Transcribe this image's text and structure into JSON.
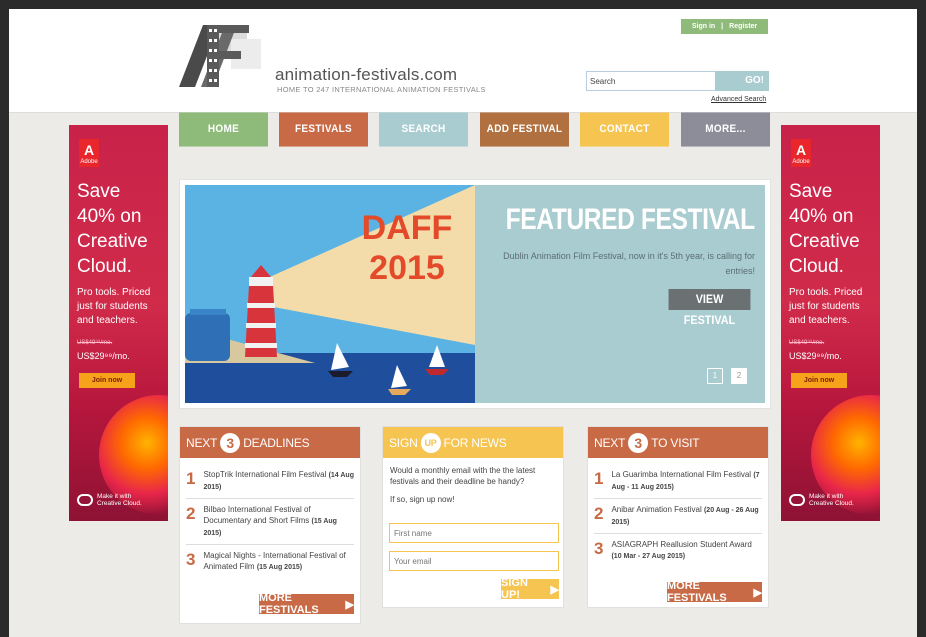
{
  "header": {
    "site_title": "animation-festivals.com",
    "tagline": "HOME TO 247 INTERNATIONAL ANIMATION FESTIVALS",
    "sign_in": "Sign in",
    "divider": "|",
    "register": "Register",
    "search_value": "Search",
    "search_button": "GO!",
    "advanced_search": "Advanced Search"
  },
  "nav": [
    {
      "label": "HOME",
      "color": "#8fbb7a"
    },
    {
      "label": "FESTIVALS",
      "color": "#c86a45"
    },
    {
      "label": "SEARCH",
      "color": "#a9ccd0"
    },
    {
      "label": "ADD FESTIVAL",
      "color": "#b0703f"
    },
    {
      "label": "CONTACT",
      "color": "#f5c451"
    },
    {
      "label": "MORE...",
      "color": "#8d8d9a"
    }
  ],
  "ad": {
    "brand": "Adobe",
    "headline_lines": [
      "Save",
      "40% on",
      "Creative",
      "Cloud."
    ],
    "body_lines": [
      "Pro tools. Priced",
      "just for students",
      "and teachers."
    ],
    "old_price": "US$49⁹⁹/mo.",
    "new_price": "US$29⁹⁹/mo.",
    "cta": "Join now",
    "footer_lines": [
      "Make it with",
      "Creative Cloud."
    ]
  },
  "hero": {
    "art_title_lines": [
      "DAFF",
      "2015"
    ],
    "heading": "FEATURED FESTIVAL",
    "description": "Dublin Animation Film Festival, now in it's 5th year, is calling for entries!",
    "button": "VIEW FESTIVAL",
    "pages": [
      "1",
      "2"
    ]
  },
  "deadlines": {
    "title_prefix": "NEXT",
    "title_num": "3",
    "title_suffix": "DEADLINES",
    "items": [
      {
        "num": "1",
        "name": "StopTrik International Film Festival",
        "date": "(14 Aug 2015)"
      },
      {
        "num": "2",
        "name": "Bilbao International Festival of Documentary and Short Films",
        "date": "(15 Aug 2015)"
      },
      {
        "num": "3",
        "name": "Magical Nights - International Festival of Animated Film",
        "date": "(15 Aug 2015)"
      }
    ],
    "more": "MORE FESTIVALS"
  },
  "news": {
    "title_prefix": "SIGN",
    "title_num": "UP",
    "title_suffix": "FOR NEWS",
    "question": "Would a monthly email with the the latest festivals and their deadline be handy?",
    "prompt": "If so, sign up now!",
    "first_name_placeholder": "First name",
    "email_placeholder": "Your email",
    "button": "SIGN UP!"
  },
  "visit": {
    "title_prefix": "NEXT",
    "title_num": "3",
    "title_suffix": "TO VISIT",
    "items": [
      {
        "num": "1",
        "name": "La Guarimba International Film Festival",
        "date": "(7 Aug - 11 Aug 2015)"
      },
      {
        "num": "2",
        "name": "Anibar Animation Festival",
        "date": "(20 Aug - 26 Aug 2015)"
      },
      {
        "num": "3",
        "name": "ASIAGRAPH Reallusion Student Award",
        "date": "(10 Mar - 27 Aug 2015)"
      }
    ],
    "more": "MORE FESTIVALS"
  },
  "colors": {
    "green": "#8fbb7a",
    "rust": "#c86a45",
    "teal": "#a9ccd0",
    "yellow": "#f5c451",
    "adobe_red": "#d12b4a"
  }
}
